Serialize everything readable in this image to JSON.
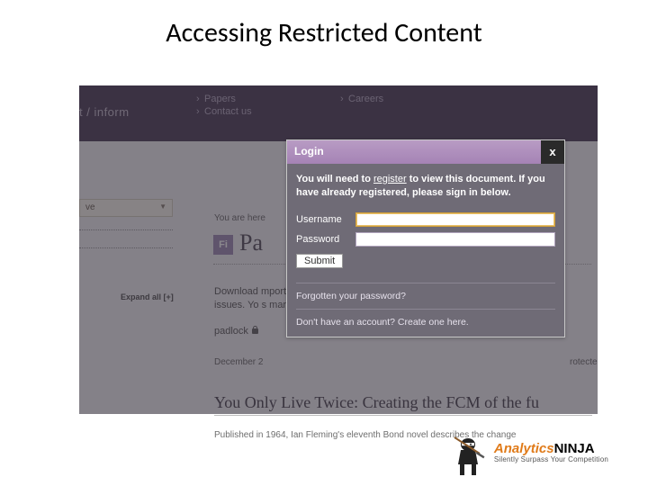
{
  "slide": {
    "title": "Accessing Restricted Content"
  },
  "topnav": {
    "brand": "t / inform",
    "col1": [
      "Papers",
      "Contact us"
    ],
    "col2": [
      "Careers"
    ]
  },
  "page": {
    "sidebar": {
      "select_value": "ve",
      "expand": "Expand all [+]"
    },
    "crumbs": "You are here",
    "doc_badge": "Fi",
    "doc_title": "Pa",
    "body_para": "Download                                                                                                                       mport\nissues. Yo                                                                                                                         s mark",
    "padlock_label": "padlock",
    "date": "December 2",
    "protected": "rotecte",
    "article_heading": "You Only Live Twice: Creating the FCM of the fu",
    "article_para": "Published in 1964, Ian Fleming's eleventh Bond novel describes the change"
  },
  "modal": {
    "title": "Login",
    "close": "x",
    "message_prefix": "You will need to ",
    "message_register": "register",
    "message_suffix": " to view this document. If you have already registered, please sign in below.",
    "username_label": "Username",
    "password_label": "Password",
    "submit": "Submit",
    "forgot": "Forgotten your password?",
    "create": "Don't have an account? Create one here."
  },
  "footer": {
    "brand_a": "Analytics",
    "brand_b": "NINJA",
    "tagline": "Silently Surpass Your Competition"
  }
}
